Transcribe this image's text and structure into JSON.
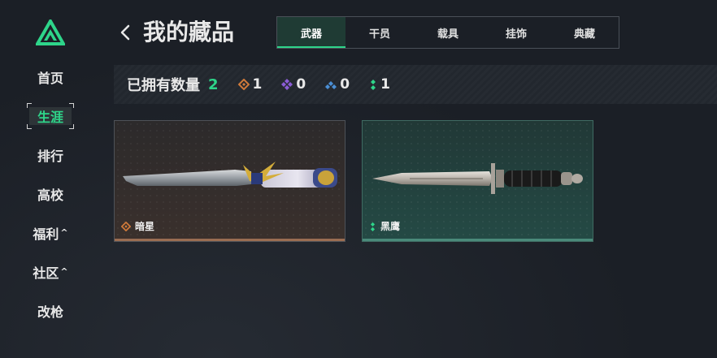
{
  "sidebar": {
    "items": [
      {
        "label": "首页"
      },
      {
        "label": "生涯"
      },
      {
        "label": "排行"
      },
      {
        "label": "高校"
      },
      {
        "label": "福利"
      },
      {
        "label": "社区"
      },
      {
        "label": "改枪"
      }
    ],
    "caret": "^"
  },
  "header": {
    "title": "我的藏品",
    "tabs": [
      {
        "label": "武器"
      },
      {
        "label": "干员"
      },
      {
        "label": "载具"
      },
      {
        "label": "挂饰"
      },
      {
        "label": "典藏"
      }
    ]
  },
  "stats": {
    "owned_label": "已拥有数量",
    "owned_count": "2",
    "items": [
      {
        "icon": "orange-diamond-icon",
        "color": "#d07a3a",
        "value": "1"
      },
      {
        "icon": "purple-diamond-icon",
        "color": "#8b5cd6",
        "value": "0"
      },
      {
        "icon": "blue-diamond-icon",
        "color": "#4a8fd6",
        "value": "0"
      },
      {
        "icon": "green-dots-icon",
        "color": "#2ed58a",
        "value": "1"
      }
    ]
  },
  "collection": [
    {
      "name": "暗星",
      "rarity_icon": "orange-diamond-icon",
      "rarity_color": "#d07a3a"
    },
    {
      "name": "黑鹰",
      "rarity_icon": "green-dots-icon",
      "rarity_color": "#2ed58a"
    }
  ],
  "colors": {
    "accent": "#2ed58a",
    "background": "#1b1f26"
  }
}
